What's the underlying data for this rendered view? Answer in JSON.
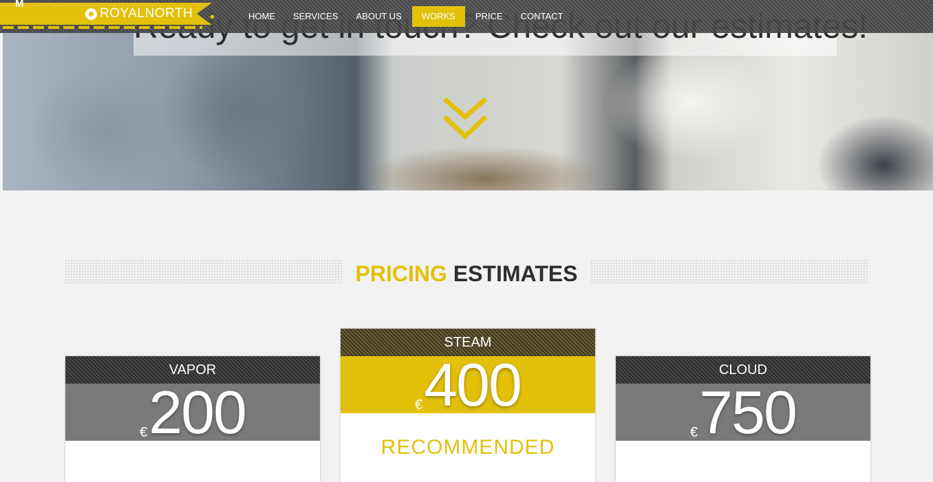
{
  "brand": {
    "name": "ROYALNORTH",
    "logo_mark": "M",
    "icon": "smiley-icon"
  },
  "nav": {
    "items": [
      {
        "label": "HOME",
        "active": false
      },
      {
        "label": "SERVICES",
        "active": false
      },
      {
        "label": "ABOUT US",
        "active": false
      },
      {
        "label": "WORKS",
        "active": true
      },
      {
        "label": "PRICE",
        "active": false
      },
      {
        "label": "CONTACT",
        "active": false
      }
    ]
  },
  "hero": {
    "title": "Ready to get in touch? Check out our estimates!",
    "scroll_icon": "double-chevron-down-icon"
  },
  "pricing": {
    "title_highlight": "PRICING",
    "title_rest": "ESTIMATES",
    "plans": [
      {
        "name": "VAPOR",
        "currency": "€",
        "price": "200",
        "featured": false
      },
      {
        "name": "STEAM",
        "currency": "€",
        "price": "400",
        "featured": true,
        "note": "RECOMMENDED"
      },
      {
        "name": "CLOUD",
        "currency": "€",
        "price": "750",
        "featured": false
      }
    ]
  },
  "colors": {
    "accent": "#e3c00a",
    "dark": "#2e2e2e",
    "price_bg": "#7a7a7a"
  }
}
